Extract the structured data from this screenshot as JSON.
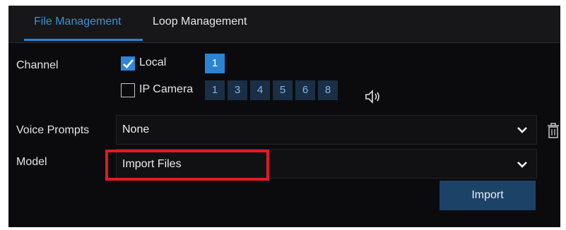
{
  "tabs": [
    {
      "label": "File Management",
      "active": true
    },
    {
      "label": "Loop Management",
      "active": false
    }
  ],
  "channel": {
    "label": "Channel",
    "local": {
      "label": "Local",
      "checked": true,
      "channels": [
        "1"
      ]
    },
    "ip_camera": {
      "label": "IP Camera",
      "checked": false,
      "channels": [
        "1",
        "3",
        "4",
        "5",
        "6",
        "8"
      ]
    }
  },
  "voice_prompts": {
    "label": "Voice Prompts",
    "value": "None"
  },
  "model": {
    "label": "Model",
    "value": "Import Files"
  },
  "import_button": "Import",
  "colors": {
    "accent": "#2b84d3",
    "highlight": "#e11b22",
    "button": "#1d4268"
  }
}
